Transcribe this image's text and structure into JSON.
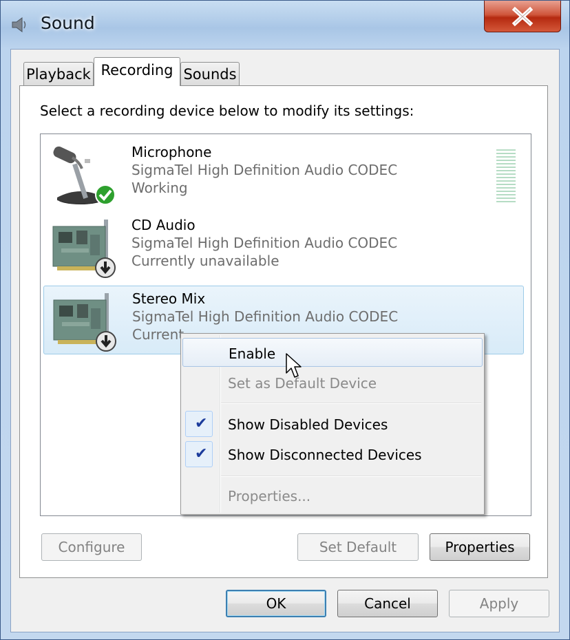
{
  "window": {
    "title": "Sound",
    "close_glyph": "✕"
  },
  "tabs": [
    {
      "label": "Playback",
      "active": false
    },
    {
      "label": "Recording",
      "active": true
    },
    {
      "label": "Sounds",
      "active": false
    }
  ],
  "instruction": "Select a recording device below to modify its settings:",
  "devices": [
    {
      "name": "Microphone",
      "driver": "SigmaTel High Definition Audio CODEC",
      "status": "Working",
      "icon": "microphone-icon",
      "badge": "green-check"
    },
    {
      "name": "CD Audio",
      "driver": "SigmaTel High Definition Audio CODEC",
      "status": "Currently unavailable",
      "icon": "sound-card-icon",
      "badge": "down-arrow"
    },
    {
      "name": "Stereo Mix",
      "driver": "SigmaTel High Definition Audio CODEC",
      "status": "Current",
      "icon": "sound-card-icon",
      "badge": "down-arrow",
      "selected": true
    }
  ],
  "context_menu": {
    "items": [
      {
        "label": "Enable",
        "enabled": true,
        "hover": true
      },
      {
        "label": "Set as Default Device",
        "enabled": false
      },
      {
        "label": "Show Disabled Devices",
        "enabled": true,
        "checked": true
      },
      {
        "label": "Show Disconnected Devices",
        "enabled": true,
        "checked": true
      },
      {
        "label": "Properties...",
        "enabled": false
      }
    ],
    "check_glyph": "✔"
  },
  "buttons": {
    "configure": "Configure",
    "set_default": "Set Default",
    "properties": "Properties",
    "ok": "OK",
    "cancel": "Cancel",
    "apply": "Apply"
  },
  "colors": {
    "selection": "#d8ebf8",
    "check": "#1c3c9c",
    "close": "#c8452a",
    "status_ok": "#2ea02e"
  }
}
